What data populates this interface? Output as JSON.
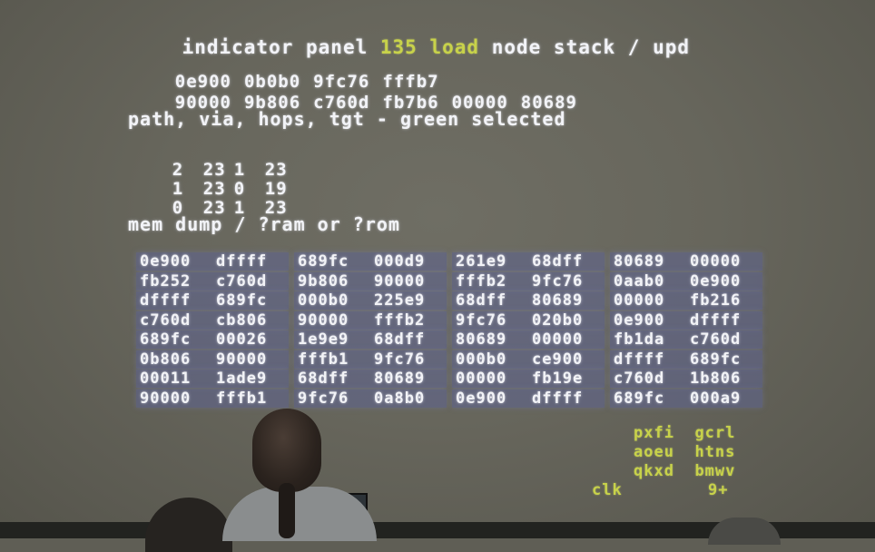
{
  "title_row": [
    {
      "text": "indicator panel",
      "color": "white"
    },
    {
      "text": "135",
      "color": "green"
    },
    {
      "text": "load",
      "color": "green"
    },
    {
      "text": "node stack / upd",
      "color": "white"
    }
  ],
  "stack_rows": [
    [
      "0e900",
      "0b0b0",
      "9fc76",
      "fffb7"
    ],
    [
      "90000",
      "9b806",
      "c760d",
      "fb7b6",
      "00000",
      "80689"
    ]
  ],
  "path_heading": "path, via, hops, tgt - green selected",
  "path_rows": [
    [
      "2",
      "23",
      "1",
      "23"
    ],
    [
      "1",
      "23",
      "0",
      "19"
    ],
    [
      "0",
      "23",
      "1",
      "23"
    ]
  ],
  "mem_heading": "mem dump / ?ram or ?rom",
  "mem_rows": [
    [
      "0e900",
      "dffff",
      "689fc",
      "000d9",
      "261e9",
      "68dff",
      "80689",
      "00000"
    ],
    [
      "fb252",
      "c760d",
      "9b806",
      "90000",
      "fffb2",
      "9fc76",
      "0aab0",
      "0e900"
    ],
    [
      "dffff",
      "689fc",
      "000b0",
      "225e9",
      "68dff",
      "80689",
      "00000",
      "fb216"
    ],
    [
      "c760d",
      "cb806",
      "90000",
      "fffb2",
      "9fc76",
      "020b0",
      "0e900",
      "dffff"
    ],
    [
      "689fc",
      "00026",
      "1e9e9",
      "68dff",
      "80689",
      "00000",
      "fb1da",
      "c760d"
    ],
    [
      "0b806",
      "90000",
      "fffb1",
      "9fc76",
      "000b0",
      "ce900",
      "dffff",
      "689fc"
    ],
    [
      "00011",
      "1ade9",
      "68dff",
      "80689",
      "00000",
      "fb19e",
      "c760d",
      "1b806"
    ],
    [
      "90000",
      "fffb1",
      "9fc76",
      "0a8b0",
      "0e900",
      "dffff",
      "689fc",
      "000a9"
    ]
  ],
  "keypad": {
    "rows": [
      [
        "pxfi",
        "gcrl"
      ],
      [
        "aoeu",
        "htns"
      ],
      [
        "qkxd",
        "bmwv"
      ]
    ],
    "left_label": "clk",
    "right_label": "9+"
  }
}
